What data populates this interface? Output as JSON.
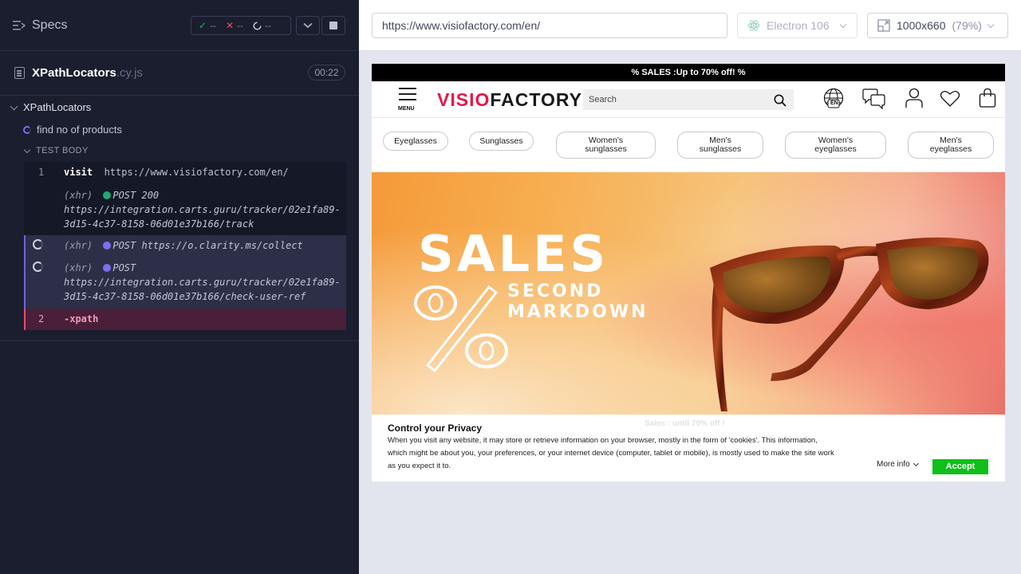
{
  "reporter": {
    "header": {
      "title": "Specs",
      "passed": "--",
      "failed": "--",
      "pending": "--"
    },
    "file": {
      "name": "XPathLocators",
      "ext": ".cy.js",
      "duration": "00:22"
    },
    "suite": {
      "title": "XPathLocators"
    },
    "test": {
      "title": "find no of products"
    },
    "body_label": "TEST BODY",
    "commands": {
      "visit": {
        "number": "1",
        "name": "visit",
        "url": "https://www.visiofactory.com/en/"
      },
      "xhr1": {
        "type": "(xhr)",
        "method": "POST 200",
        "url_line1": "https://integration.carts.guru/tracker/02e1fa89-",
        "url_line2": "3d15-4c37-8158-06d01e37b166/track"
      },
      "xhr2": {
        "type": "(xhr)",
        "method_url": "POST https://o.clarity.ms/collect"
      },
      "xhr3": {
        "type": "(xhr)",
        "method": "POST",
        "url_line1": "https://integration.carts.guru/tracker/02e1fa89-",
        "url_line2": "3d15-4c37-8158-06d01e37b166/check-user-ref"
      },
      "fail": {
        "number": "2",
        "name": "-xpath"
      }
    }
  },
  "preview": {
    "url": "https://www.visiofactory.com/en/",
    "browser": "Electron 106",
    "viewport": "1000x660",
    "scale": "(79%)"
  },
  "site": {
    "promo": "% SALES :Up to 70% off! %",
    "menu_label": "MENU",
    "logo_part1": "VISIO",
    "logo_part2": "FACTORY",
    "search_placeholder": "Search",
    "lang_badge": "EN",
    "categories": [
      {
        "line1": "Eyeglasses",
        "line2": ""
      },
      {
        "line1": "Sunglasses",
        "line2": ""
      },
      {
        "line1": "Women's",
        "line2": "sunglasses"
      },
      {
        "line1": "Men's",
        "line2": "sunglasses"
      },
      {
        "line1": "Women's",
        "line2": "eyeglasses"
      },
      {
        "line1": "Men's",
        "line2": "eyeglasses"
      }
    ],
    "banner": {
      "headline": "SALES",
      "line1": "SECOND",
      "line2": "MARKDOWN"
    },
    "cookie": {
      "ghost_text": "Sales : until 70% off !",
      "title": "Control your Privacy",
      "text": "When you visit any website, it may store or retrieve information on your browser, mostly in the form of 'cookies'. This information, which might be about you, your preferences, or your internet device (computer, tablet or mobile), is mostly used to make the site work as you expect it to.",
      "more_info": "More info",
      "accept": "Accept"
    }
  },
  "colors": {
    "reporter_bg": "#1b1e2e",
    "pass_green": "#1fa971",
    "fail_red": "#f04a6e",
    "pending_purple": "#7b6ff0",
    "brand_red": "#e5174a",
    "accept_green": "#0fbf1a"
  },
  "icons": [
    "specs-icon",
    "check-icon",
    "cross-icon",
    "spinner-icon",
    "chevron-down-icon",
    "stop-icon",
    "file-icon",
    "electron-icon",
    "viewport-icon",
    "menu-icon",
    "search-icon",
    "globe-icon",
    "chat-icon",
    "user-icon",
    "heart-icon",
    "bag-icon"
  ]
}
